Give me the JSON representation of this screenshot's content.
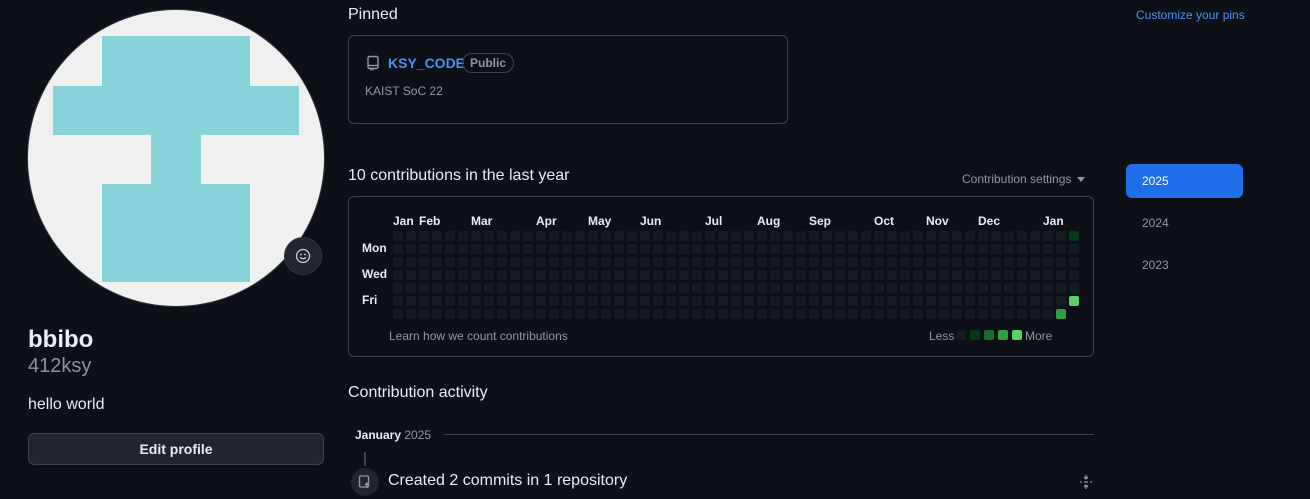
{
  "profile": {
    "display_name": "bbibo",
    "username": "412ksy",
    "bio": "hello world",
    "edit_button": "Edit profile",
    "identicon_color": "#86d3d9"
  },
  "pinned": {
    "title": "Pinned",
    "customize_link": "Customize your pins",
    "repo": {
      "name": "KSY_CODE",
      "visibility": "Public",
      "description": "KAIST SoC 22"
    }
  },
  "contributions": {
    "title": "10 contributions in the last year",
    "settings_label": "Contribution settings",
    "months": [
      "Jan",
      "Feb",
      "Mar",
      "Apr",
      "May",
      "Jun",
      "Jul",
      "Aug",
      "Sep",
      "Oct",
      "Nov",
      "Dec",
      "Jan"
    ],
    "day_labels": [
      "Mon",
      "Wed",
      "Fri"
    ],
    "learn_link": "Learn how we count contributions",
    "legend_less": "Less",
    "legend_more": "More",
    "level_colors": [
      "#151b23",
      "#033a16",
      "#196c2e",
      "#2ea043",
      "#56d364"
    ],
    "active_days": [
      {
        "week": 52,
        "weekday": 0,
        "level": 1
      },
      {
        "week": 51,
        "weekday": 6,
        "level": 3
      },
      {
        "week": 52,
        "weekday": 5,
        "level": 4
      }
    ]
  },
  "years": [
    "2025",
    "2024",
    "2023"
  ],
  "selected_year": "2025",
  "activity": {
    "title": "Contribution activity",
    "month": "January",
    "year": "2025",
    "item": "Created 2 commits in 1 repository"
  }
}
